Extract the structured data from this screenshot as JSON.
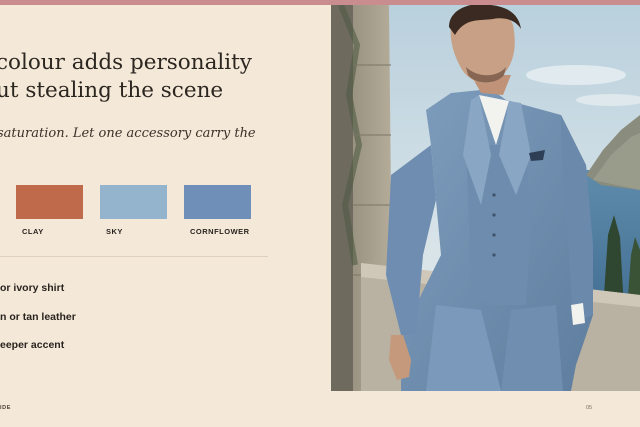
{
  "page": {
    "heading_line1": "colour adds personality",
    "heading_line2": "ut stealing the scene",
    "subhead": "saturation. Let one accessory carry the",
    "accent_bar_color": "#c98c8f",
    "background_color": "#f4e9d8"
  },
  "swatches": [
    {
      "label": "CLAY",
      "color": "#c06a4c"
    },
    {
      "label": "SKY",
      "color": "#94b3cc"
    },
    {
      "label": "CORNFLOWER",
      "color": "#6f8fb8"
    }
  ],
  "tips": [
    "or ivory shirt",
    "n or tan leather",
    "eeper accent"
  ],
  "photo": {
    "subject": "man in light blue linen three-piece suit with white shirt and pocket square, standing by a stone wall above the sea"
  },
  "footer": {
    "left": "IDE",
    "right": "05"
  }
}
